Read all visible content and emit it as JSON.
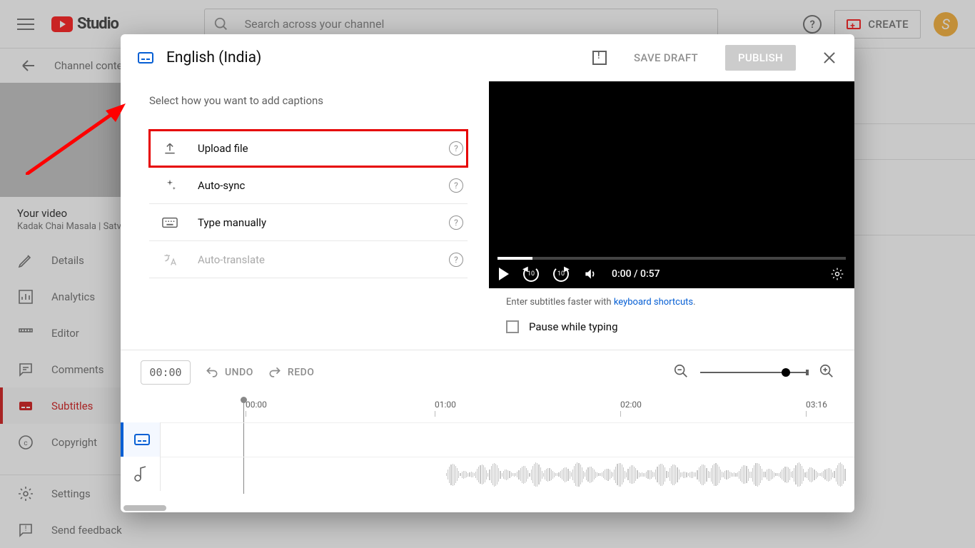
{
  "header": {
    "logo_text": "Studio",
    "search_placeholder": "Search across your channel",
    "create_label": "CREATE",
    "avatar_initial": "S"
  },
  "breadcrumb": {
    "label": "Channel content"
  },
  "sidebar": {
    "section_title": "Your video",
    "video_title": "Kadak Chai Masala | Satv",
    "items": [
      {
        "label": "Details"
      },
      {
        "label": "Analytics"
      },
      {
        "label": "Editor"
      },
      {
        "label": "Comments"
      },
      {
        "label": "Subtitles"
      },
      {
        "label": "Copyright"
      }
    ],
    "bottom": [
      {
        "label": "Settings"
      },
      {
        "label": "Send feedback"
      }
    ]
  },
  "modal": {
    "title": "English (India)",
    "save_draft": "SAVE DRAFT",
    "publish": "PUBLISH",
    "prompt": "Select how you want to add captions",
    "options": {
      "upload": "Upload file",
      "autosync": "Auto-sync",
      "manual": "Type manually",
      "autotranslate": "Auto-translate"
    },
    "video": {
      "time": "0:00 / 0:57"
    },
    "hint_prefix": "Enter subtitles faster with ",
    "hint_link": "keyboard shortcuts",
    "hint_suffix": ".",
    "pause_label": "Pause while typing",
    "toolbar": {
      "time": "00:00",
      "undo": "UNDO",
      "redo": "REDO"
    },
    "ruler": {
      "t0": "00:00",
      "t1": "01:00",
      "t2": "02:00",
      "t3": "03:16"
    }
  }
}
